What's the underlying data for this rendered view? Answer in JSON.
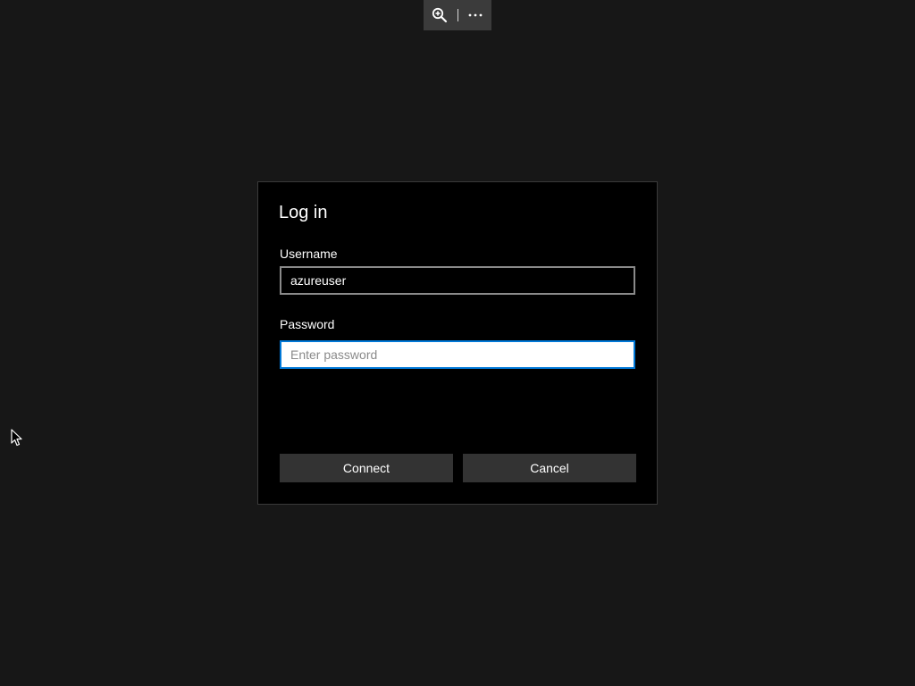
{
  "toolbar": {
    "zoom_icon": "zoom-in-icon",
    "more_icon": "more-options-icon"
  },
  "dialog": {
    "title": "Log in",
    "username_label": "Username",
    "username_value": "azureuser",
    "password_label": "Password",
    "password_placeholder": "Enter password",
    "password_value": "",
    "connect_label": "Connect",
    "cancel_label": "Cancel"
  },
  "colors": {
    "background": "#171717",
    "dialog_background": "#000000",
    "focus_accent": "#0078d7",
    "button_background": "#333333",
    "toolbar_background": "#3b3b3b"
  }
}
